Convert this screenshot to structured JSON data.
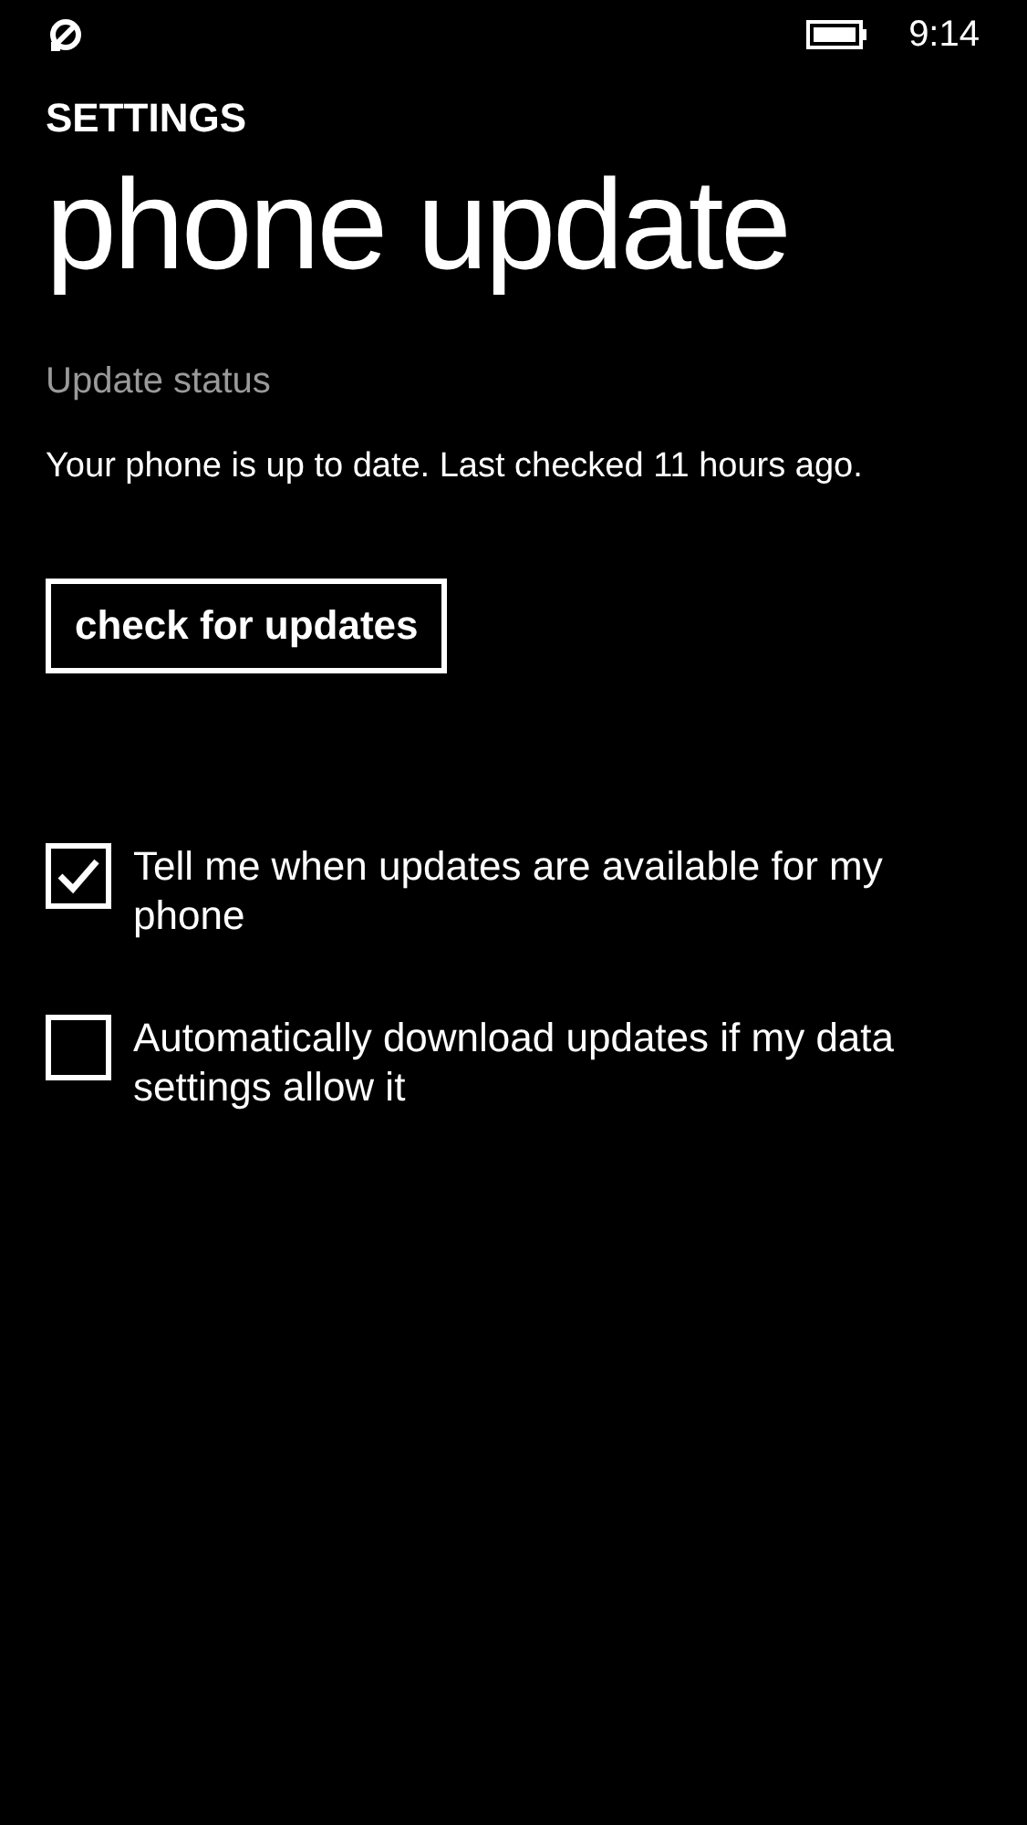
{
  "status_bar": {
    "time": "9:14"
  },
  "header": {
    "section": "SETTINGS",
    "title": "phone update"
  },
  "update_status": {
    "label": "Update status",
    "message": "Your phone is up to date. Last checked 11 hours ago."
  },
  "button": {
    "label": "check for updates"
  },
  "options": [
    {
      "label": "Tell me when updates are available for my phone",
      "checked": true
    },
    {
      "label": "Automatically download updates if my data settings allow it",
      "checked": false
    }
  ]
}
